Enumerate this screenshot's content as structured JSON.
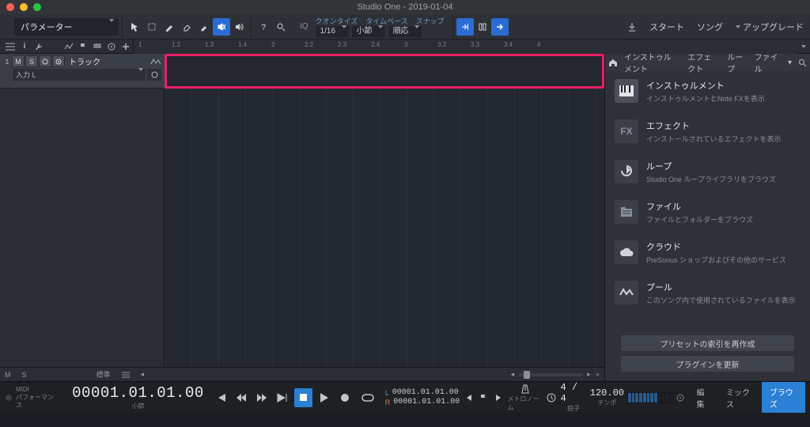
{
  "window": {
    "title": "Studio One - 2019-01-04"
  },
  "colors": {
    "accent": "#2b7fd4",
    "highlight": "#e91e63"
  },
  "toolbar": {
    "parameter_label": "パラメーター",
    "menu_labels": {
      "quantize": "クオンタイズ",
      "timebase": "タイムベース",
      "snap": "スナップ"
    },
    "quantize_value": "1/16",
    "timebase_value": "小節",
    "snap_value": "順応",
    "right_buttons": {
      "start": "スタート",
      "song": "ソング",
      "upgrade": "アップグレード"
    }
  },
  "ruler_marks": [
    "1",
    "1.2",
    "1.3",
    "1.4",
    "2",
    "2.2",
    "2.3",
    "2.4",
    "3",
    "3.2",
    "3.3",
    "3.4",
    "4"
  ],
  "track": {
    "number": "1",
    "mute": "M",
    "solo": "S",
    "name": "トラック",
    "input": "入力 L"
  },
  "arrange_status": {
    "m": "M",
    "s": "S",
    "mode": "標準"
  },
  "browser": {
    "tabs": [
      "インストゥルメント",
      "エフェクト",
      "ループ",
      "ファイル"
    ],
    "items": [
      {
        "title": "インストゥルメント",
        "sub": "インストゥルメントとNote FXを表示",
        "icon": "piano"
      },
      {
        "title": "エフェクト",
        "sub": "インストールされているエフェクトを表示",
        "icon": "fx"
      },
      {
        "title": "ループ",
        "sub": "Studio One ループライブラリをブラウズ",
        "icon": "loop"
      },
      {
        "title": "ファイル",
        "sub": "ファイルとフォルダーをブラウズ",
        "icon": "file"
      },
      {
        "title": "クラウド",
        "sub": "PreSonus ショップおよびその他のサービス",
        "icon": "cloud"
      },
      {
        "title": "プール",
        "sub": "このソング内で使用されているファイルを表示",
        "icon": "pool"
      }
    ],
    "buttons": {
      "rebuild": "プリセットの索引を再作成",
      "update": "プラグインを更新"
    }
  },
  "transport": {
    "midi_label": "MIDI",
    "perf_label": "パフォーマンス",
    "main_time": "00001.01.01.00",
    "main_unit": "小節",
    "loc_l": "L",
    "loc_r": "R",
    "loc_l_time": "00001.01.01.00",
    "loc_r_time": "00001.01.01.00",
    "metronome_label": "メトロノーム",
    "timesig": "4 / 4",
    "timesig_label": "拍子",
    "tempo": "120.00",
    "tempo_label": "テンポ",
    "footer_tabs": {
      "edit": "編集",
      "mix": "ミックス",
      "browse": "ブラウズ"
    }
  }
}
